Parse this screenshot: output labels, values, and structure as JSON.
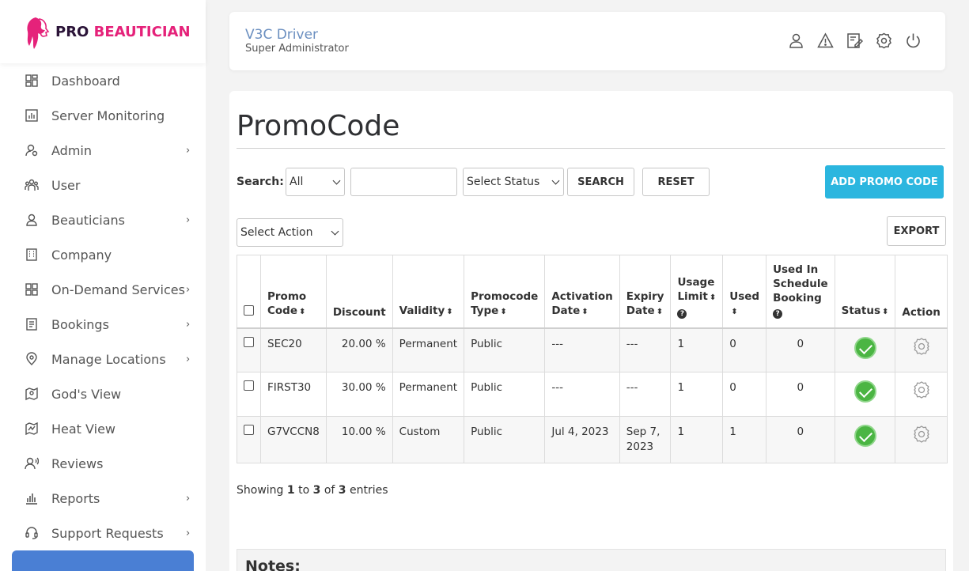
{
  "brand": {
    "pro": "PRO",
    "beautician": "BEAUTICIAN"
  },
  "sidebar": {
    "items": [
      {
        "label": "Dashboard",
        "icon": "dashboard-icon",
        "has_submenu": false
      },
      {
        "label": "Server Monitoring",
        "icon": "chart-icon",
        "has_submenu": false
      },
      {
        "label": "Admin",
        "icon": "admin-icon",
        "has_submenu": true
      },
      {
        "label": "User",
        "icon": "users-icon",
        "has_submenu": false
      },
      {
        "label": "Beauticians",
        "icon": "beautician-icon",
        "has_submenu": true
      },
      {
        "label": "Company",
        "icon": "building-icon",
        "has_submenu": false
      },
      {
        "label": "On-Demand Services",
        "icon": "grid-icon",
        "has_submenu": true
      },
      {
        "label": "Bookings",
        "icon": "bookings-icon",
        "has_submenu": true
      },
      {
        "label": "Manage Locations",
        "icon": "location-icon",
        "has_submenu": true
      },
      {
        "label": "God's View",
        "icon": "map-icon",
        "has_submenu": false
      },
      {
        "label": "Heat View",
        "icon": "heat-map-icon",
        "has_submenu": false
      },
      {
        "label": "Reviews",
        "icon": "reviews-icon",
        "has_submenu": false
      },
      {
        "label": "Reports",
        "icon": "reports-icon",
        "has_submenu": true
      },
      {
        "label": "Support Requests",
        "icon": "headset-icon",
        "has_submenu": true
      }
    ],
    "chevron": "›"
  },
  "header": {
    "user_name": "V3C Driver",
    "user_role": "Super Administrator",
    "icons": [
      "user-icon",
      "warning-icon",
      "edit-icon",
      "settings-icon",
      "power-icon"
    ]
  },
  "page": {
    "title": "PromoCode",
    "search_label": "Search:",
    "search_field_select": "All",
    "search_input_value": "",
    "status_select": "Select Status",
    "search_button": "SEARCH",
    "reset_button": "RESET",
    "add_button": "ADD PROMO CODE",
    "action_select": "Select Action",
    "export_button": "EXPORT"
  },
  "table": {
    "headers": {
      "promo_code": [
        "Promo",
        "Code"
      ],
      "discount": "Discount",
      "validity": "Validity",
      "promocode_type": [
        "Promocode",
        "Type"
      ],
      "activation_date": [
        "Activation",
        "Date"
      ],
      "expiry_date": [
        "Expiry",
        "Date"
      ],
      "usage_limit": [
        "Usage",
        "Limit"
      ],
      "used": "Used",
      "used_in_schedule": [
        "Used In",
        "Schedule",
        "Booking"
      ],
      "status": "Status",
      "action": "Action"
    },
    "rows": [
      {
        "code": "SEC20",
        "discount": "20.00 %",
        "validity": "Permanent",
        "type": "Public",
        "activation": "---",
        "expiry": "---",
        "usage_limit": "1",
        "used": "0",
        "schedule": "0"
      },
      {
        "code": "FIRST30",
        "discount": "30.00 %",
        "validity": "Permanent",
        "type": "Public",
        "activation": "---",
        "expiry": "---",
        "usage_limit": "1",
        "used": "0",
        "schedule": "0"
      },
      {
        "code": "G7VCCN8",
        "discount": "10.00 %",
        "validity": "Custom",
        "type": "Public",
        "activation": "Jul 4, 2023",
        "expiry": "Sep 7, 2023",
        "usage_limit": "1",
        "used": "1",
        "schedule": "0"
      }
    ]
  },
  "footer": {
    "showing_prefix": "Showing",
    "from": "1",
    "to_word": "to",
    "to": "3",
    "of_word": "of",
    "total": "3",
    "suffix": "entries"
  },
  "notes": {
    "title": "Notes:"
  },
  "colors": {
    "brand_pink": "#e5227a",
    "primary": "#2bb6df",
    "status_green": "#4bb543",
    "header_name": "#6b8fc0"
  }
}
